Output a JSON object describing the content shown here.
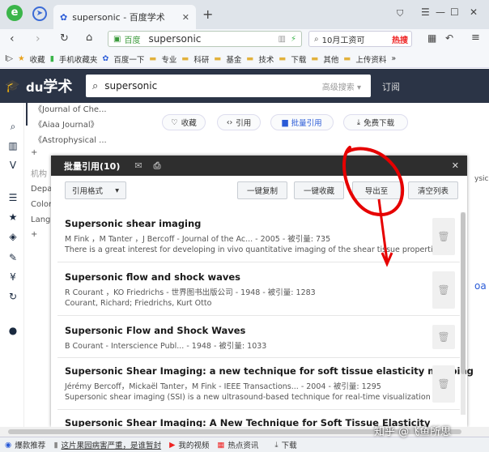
{
  "browser": {
    "tab_title": "supersonic - 百度学术",
    "url_prefix": "百度",
    "url": "supersonic",
    "search_text": "10月工资可",
    "hot_label": "热搜"
  },
  "bookmarks": [
    "收藏",
    "手机收藏夹",
    "百度一下",
    "专业",
    "科研",
    "基金",
    "技术",
    "下载",
    "其他",
    "上传资料",
    "»"
  ],
  "site": {
    "logo_text": "学术",
    "search_value": "supersonic",
    "advanced_search": "高级搜索",
    "subscribe": "订阅"
  },
  "left_refs": [
    "《Journal of Che...",
    "《Aiaa Journal》",
    "《Astrophysical ...",
    "+",
    "机构",
    "Depa",
    "Colora",
    "Langle",
    "+"
  ],
  "action_buttons": [
    "收藏",
    "引用",
    "批量引用",
    "免费下载"
  ],
  "modal": {
    "title": "批量引用(10)",
    "format_label": "引用格式",
    "buttons": {
      "copy": "一键复制",
      "collect": "一键收藏",
      "export": "导出至",
      "clear": "清空列表"
    }
  },
  "items": [
    {
      "title": "Supersonic shear imaging",
      "meta": "M Fink ，M Tanter ，J Bercoff - Journal of the Ac... - 2005 - 被引量: 735",
      "snippet": "There is a great interest for developing in vivo quantitative imaging of the shear tissue properties..."
    },
    {
      "title": "Supersonic flow and shock waves",
      "meta": "R Courant ，KO Friedrichs - 世界图书出版公司 - 1948 - 被引量: 1283",
      "snippet": "Courant, Richard; Friedrichs, Kurt Otto"
    },
    {
      "title": "Supersonic Flow and Shock Waves",
      "meta": "B Courant - Interscience Publ... - 1948 - 被引量: 1033",
      "snippet": ""
    },
    {
      "title": "Supersonic Shear Imaging: a new technique for soft tissue elasticity mapping",
      "meta": "Jérémy Bercoff，Mickaël Tanter，M Fink - IEEE Transactions... - 2004 - 被引量: 1295",
      "snippet": "Supersonic shear imaging (SSI) is a new ultrasound-based technique for real-time visualization ..."
    },
    {
      "title": "Supersonic Shear Imaging: A New Technique for Soft Tissue Elasticity",
      "meta": "",
      "snippet": ""
    }
  ],
  "status": [
    "爆款推荐",
    "这片果园病害严重，是谁暂封",
    "我的视频",
    "热点资讯",
    "下载"
  ],
  "watermark": "知乎 @飞鱼所思",
  "right_edge": [
    "ysic",
    "oa"
  ]
}
